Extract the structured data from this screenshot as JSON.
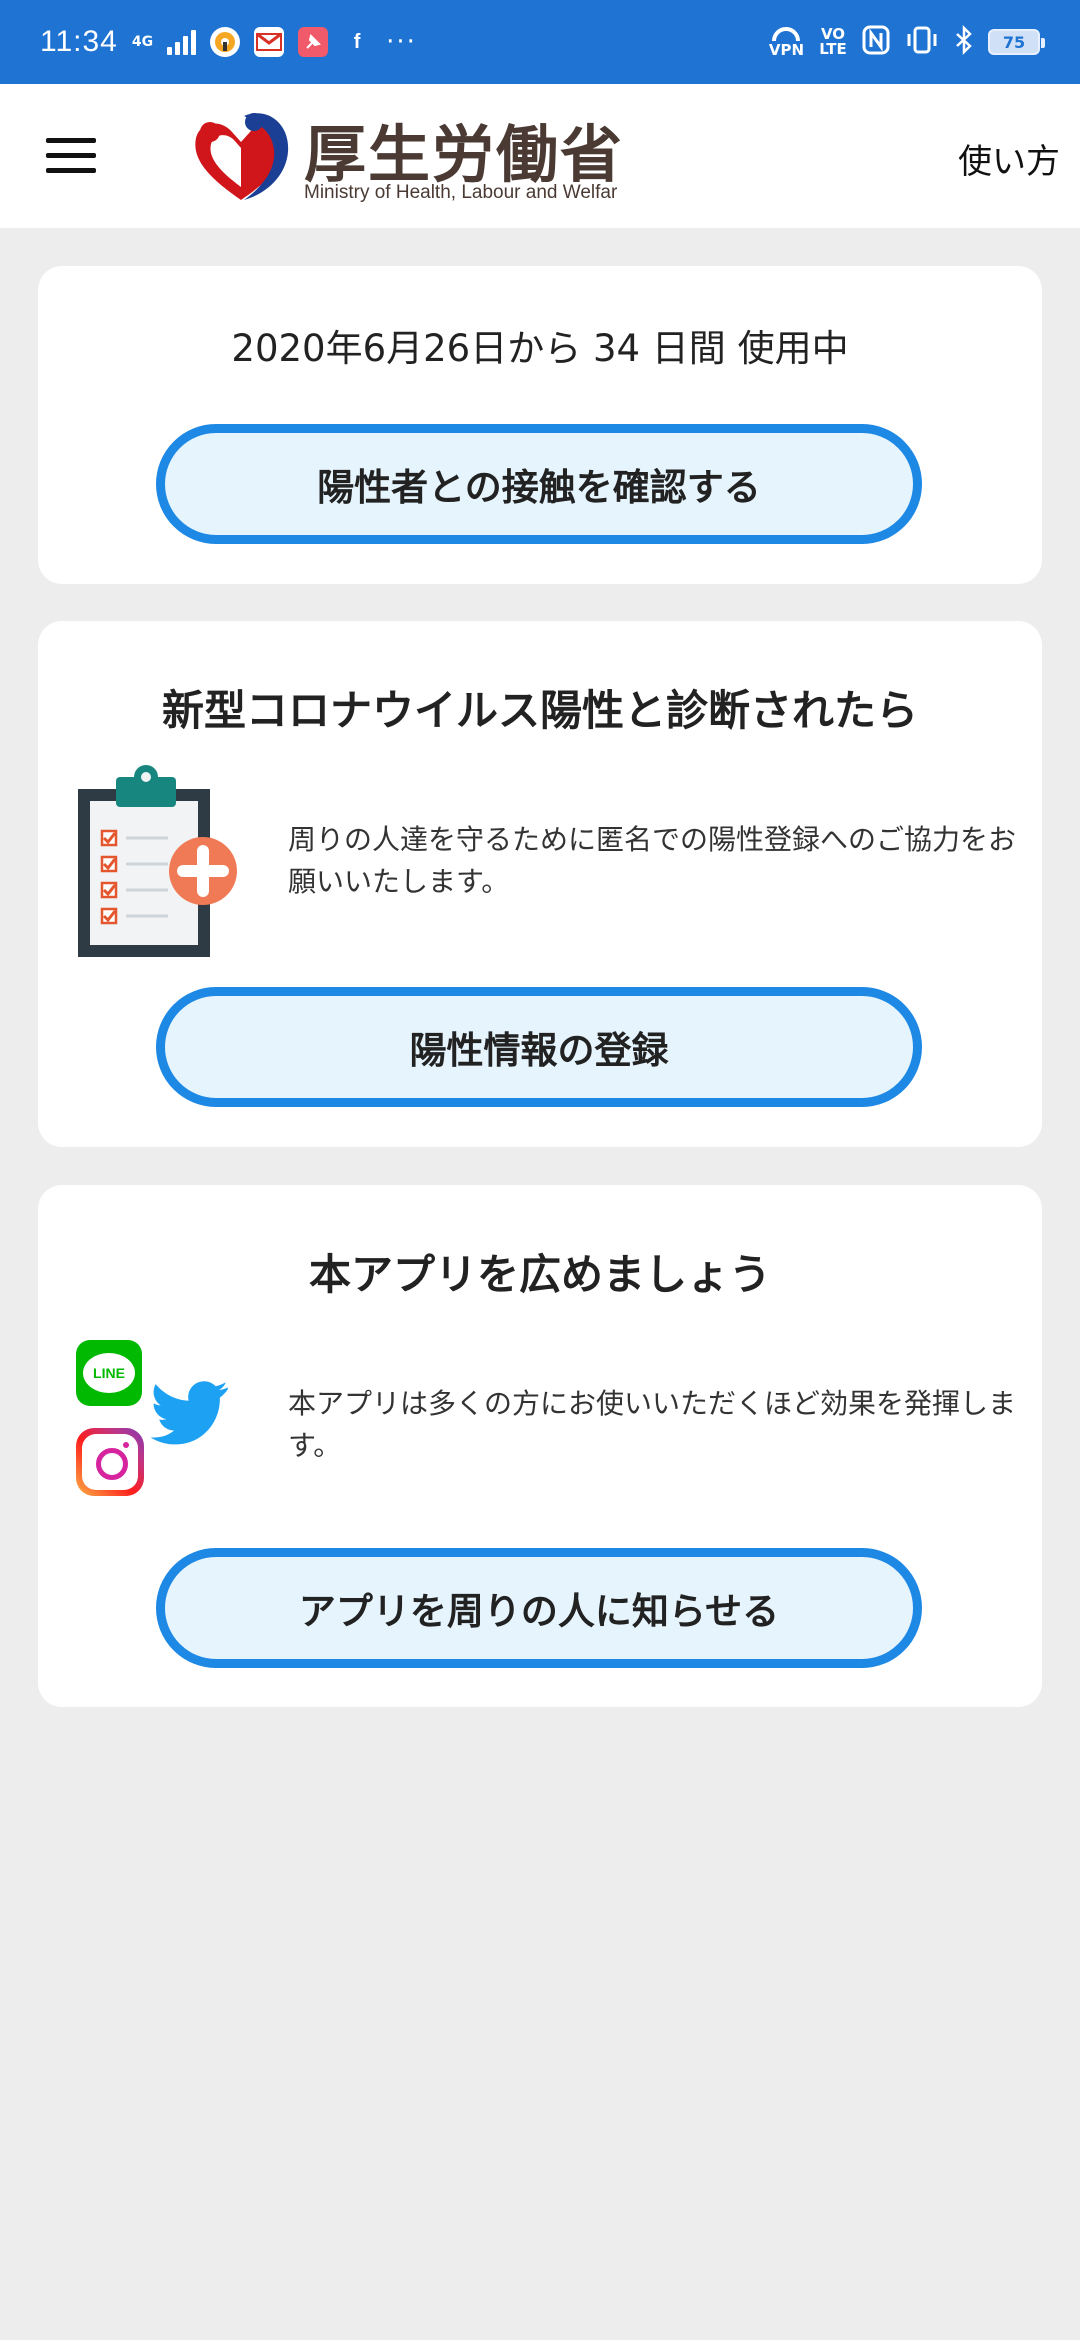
{
  "status_bar": {
    "time": "11:34",
    "network": "4G",
    "notification_icons": [
      "radio-icon",
      "gmail-icon",
      "pin-icon",
      "facebook-icon"
    ],
    "more": "···",
    "vpn": "VPN",
    "volte": "VO LTE",
    "nfc": "N",
    "battery": "75"
  },
  "header": {
    "logo_title": "厚生労働省",
    "logo_subtitle": "Ministry of Health, Labour and Welfar",
    "help_link": "使い方"
  },
  "usage_card": {
    "usage_text": "2020年6月26日から 34 日間 使用中",
    "button_label": "陽性者との接触を確認する"
  },
  "positive_card": {
    "title": "新型コロナウイルス陽性と診断されたら",
    "description": "周りの人達を守るために匿名での陽性登録へのご協力をお願いいたします。",
    "button_label": "陽性情報の登録"
  },
  "share_card": {
    "title": "本アプリを広めましょう",
    "line_label": "LINE",
    "description": "本アプリは多くの方にお使いいただくほど効果を発揮します。",
    "button_label": "アプリを周りの人に知らせる"
  },
  "colors": {
    "status_bar": "#1f73d2",
    "button_border": "#1e88e5",
    "button_fill": "#e5f4fd",
    "background": "#ededed"
  }
}
